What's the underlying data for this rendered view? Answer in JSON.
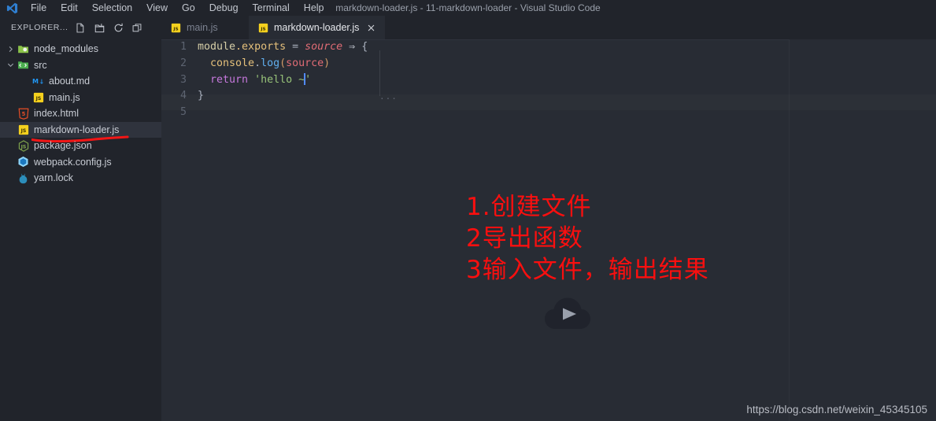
{
  "window": {
    "title": "markdown-loader.js - 11-markdown-loader - Visual Studio Code",
    "logo_icon": "vscode-logo-icon"
  },
  "menubar": {
    "items": [
      {
        "label": "File"
      },
      {
        "label": "Edit"
      },
      {
        "label": "Selection"
      },
      {
        "label": "View"
      },
      {
        "label": "Go"
      },
      {
        "label": "Debug"
      },
      {
        "label": "Terminal"
      },
      {
        "label": "Help"
      }
    ]
  },
  "sidebar": {
    "title": "EXPLORER...",
    "actions": [
      {
        "name": "new-file-icon",
        "tooltip": "New File"
      },
      {
        "name": "new-folder-icon",
        "tooltip": "New Folder"
      },
      {
        "name": "refresh-icon",
        "tooltip": "Refresh Explorer"
      },
      {
        "name": "collapse-all-icon",
        "tooltip": "Collapse Folders in Explorer"
      }
    ],
    "tree": [
      {
        "label": "node_modules",
        "type": "folder",
        "icon": "folder-icon",
        "expanded": false,
        "chevron": "chevron-right-icon",
        "indent": 0,
        "selected": false
      },
      {
        "label": "src",
        "type": "folder",
        "icon": "folder-src-icon",
        "expanded": true,
        "chevron": "chevron-down-icon",
        "indent": 0,
        "selected": false
      },
      {
        "label": "about.md",
        "type": "file",
        "icon": "markdown-icon",
        "indent": 2,
        "selected": false
      },
      {
        "label": "main.js",
        "type": "file",
        "icon": "js-icon",
        "indent": 2,
        "selected": false
      },
      {
        "label": "index.html",
        "type": "file",
        "icon": "html-icon",
        "indent": 1,
        "selected": false
      },
      {
        "label": "markdown-loader.js",
        "type": "file",
        "icon": "js-icon",
        "indent": 1,
        "selected": true
      },
      {
        "label": "package.json",
        "type": "file",
        "icon": "nodejs-icon",
        "indent": 1,
        "selected": false
      },
      {
        "label": "webpack.config.js",
        "type": "file",
        "icon": "webpack-icon",
        "indent": 1,
        "selected": false
      },
      {
        "label": "yarn.lock",
        "type": "file",
        "icon": "yarn-icon",
        "indent": 1,
        "selected": false
      }
    ]
  },
  "tabs": [
    {
      "label": "main.js",
      "icon": "js-icon",
      "active": false,
      "closable": false
    },
    {
      "label": "markdown-loader.js",
      "icon": "js-icon",
      "active": true,
      "closable": true,
      "close_icon": "close-icon"
    }
  ],
  "editor": {
    "line_numbers": [
      "1",
      "2",
      "3",
      "4",
      "5"
    ],
    "code": {
      "line1": {
        "module": "module",
        "dot_exports": ".exports",
        "equals": " = ",
        "source": "source",
        "arrow": " ⇒ ",
        "brace": "{"
      },
      "line2": {
        "indent": "  ",
        "console": "console",
        "dot": ".",
        "log": "log",
        "open": "(",
        "source": "source",
        "close": ")"
      },
      "line3": {
        "indent": "  ",
        "keyword": "return",
        "space": " ",
        "string_open": "'hello ~",
        "string_close": "'"
      },
      "line4": {
        "brace": "}"
      },
      "line5": {
        "text": ""
      }
    },
    "fold_dots": "···"
  },
  "annotation": {
    "color": "#fa0f0f",
    "lines": [
      "1.创建文件",
      "2导出函数",
      "3输入文件，输出结果"
    ]
  },
  "play_button": {
    "name": "play-icon",
    "label": "Play"
  },
  "watermark": {
    "text": "https://blog.csdn.net/weixin_45345105"
  },
  "colors": {
    "titlebar_bg": "#21242b",
    "sidebar_bg": "#21242b",
    "editor_bg": "#282c34",
    "selection_bg": "#2f333d",
    "accent_red": "#fa0f0f",
    "js_yellow": "#f5d11e",
    "string_green": "#98c379",
    "keyword_purple": "#c678dd",
    "function_blue": "#61afef"
  }
}
